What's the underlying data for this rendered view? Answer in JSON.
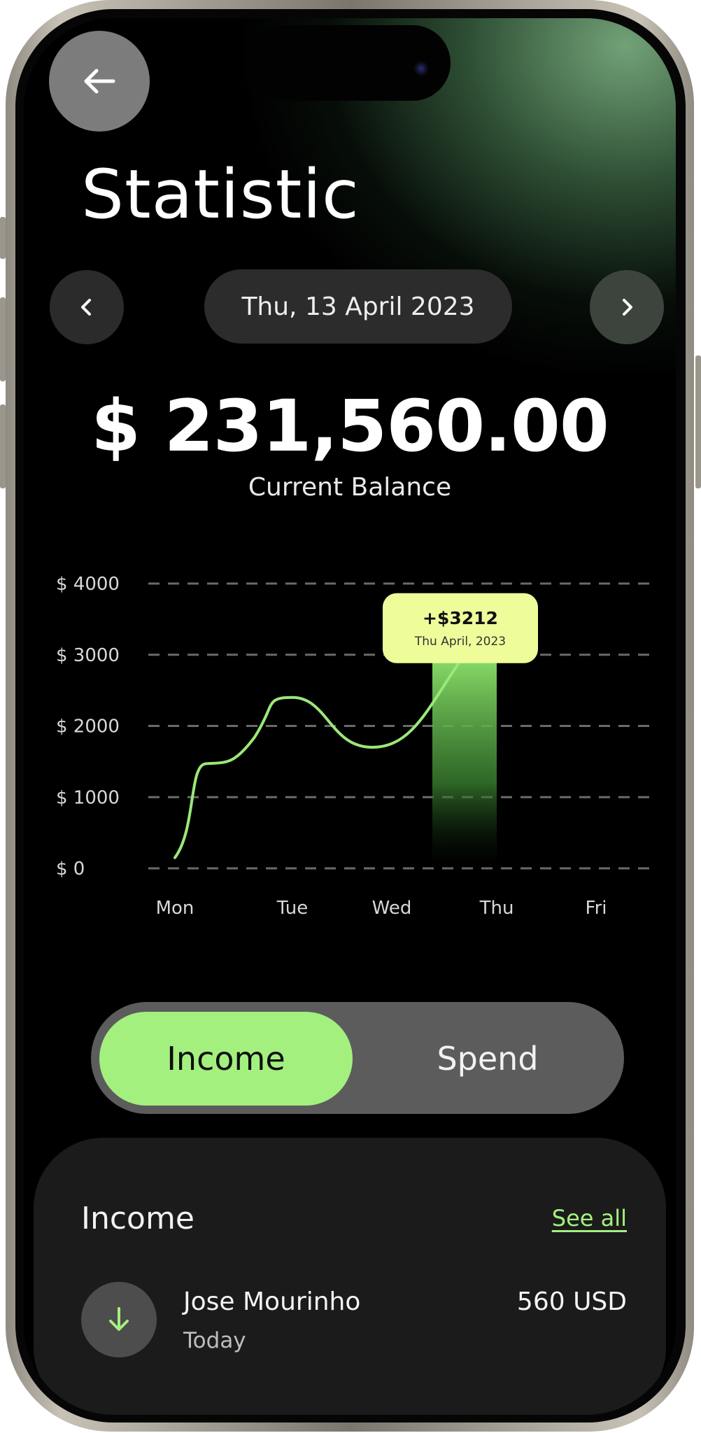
{
  "header": {
    "title": "Statistic",
    "back_icon": "arrow-left-icon"
  },
  "date_nav": {
    "prev_icon": "chevron-left-icon",
    "next_icon": "chevron-right-icon",
    "date_label": "Thu, 13 April 2023"
  },
  "balance": {
    "amount": "$ 231,560.00",
    "label": "Current Balance"
  },
  "chart_data": {
    "type": "line",
    "x": [
      "Mon",
      "Tue",
      "Wed",
      "Thu",
      "Fri"
    ],
    "x_tick_labels": [
      "Mon",
      "Tue",
      "Wed",
      "Thu",
      "Fri"
    ],
    "y_tick_labels": [
      "$4000",
      "$3000",
      "$2000",
      "$1000",
      "$0"
    ],
    "ylim": [
      0,
      4000
    ],
    "grid": true,
    "highlight_category": "Thu",
    "points": [
      {
        "x": "Mon",
        "y": 150
      },
      {
        "x": "Mon-Tue",
        "y": 1450
      },
      {
        "x": "Tue",
        "y": 2400
      },
      {
        "x": "Wed",
        "y": 1700
      },
      {
        "x": "Thu",
        "y": 3000
      }
    ],
    "tooltip": {
      "value": "+$3212",
      "date": "Thu April, 2023"
    },
    "colors": {
      "line": "#9be87a",
      "highlight": "#8be06a",
      "tooltip_bg": "#eefc9a"
    }
  },
  "toggle": {
    "income_label": "Income",
    "spend_label": "Spend",
    "active": "Income"
  },
  "income_card": {
    "title": "Income",
    "see_all_label": "See all",
    "transactions": [
      {
        "name": "Jose Mourinho",
        "date": "Today",
        "amount": "560 USD",
        "icon": "arrow-down-icon"
      }
    ]
  },
  "colors": {
    "accent": "#a3f07f",
    "background": "#000000",
    "card": "#1b1b1b"
  }
}
